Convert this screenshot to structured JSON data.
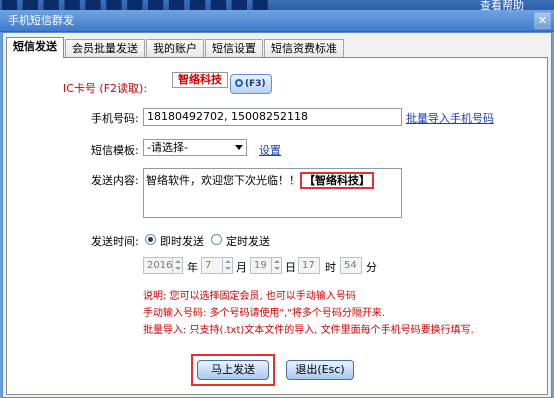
{
  "window": {
    "title": "手机短信群发",
    "close_glyph": "✕",
    "top_link": "查看帮助"
  },
  "tabs": [
    "短信发送",
    "会员批量发送",
    "我的账户",
    "短信设置",
    "短信资费标准"
  ],
  "card": {
    "label": "IC卡号 (F2读取):",
    "value": "智络科技",
    "button": "(F3)"
  },
  "phone": {
    "label": "手机号码:",
    "value": "18180492702, 15008252118",
    "import_link": "批量导入手机号码"
  },
  "template": {
    "label": "短信模板:",
    "selected": "-请选择-",
    "settings_link": "设置"
  },
  "content": {
    "label": "发送内容:",
    "text": "智络软件，欢迎您下次光临！！",
    "signature": "【智络科技】"
  },
  "send_time": {
    "label": "发送时间:",
    "options": [
      "即时发送",
      "定时发送"
    ],
    "selected": "即时发送",
    "year": "2016",
    "year_unit": "年",
    "month": "7",
    "month_unit": "月",
    "day": "19",
    "day_unit": "日",
    "hour": "17",
    "hour_unit": "时",
    "minute": "54",
    "minute_unit": "分"
  },
  "notes": [
    "说明: 您可以选择固定会员, 也可以手动输入号码",
    "手动输入号码: 多个号码请使用\",\"将多个号码分隔开来.",
    "批量导入: 只支持(.txt)文本文件的导入, 文件里面每个手机号码要换行填写."
  ],
  "buttons": {
    "send": "马上发送",
    "exit": "退出(Esc)"
  },
  "colors": {
    "accent_red": "#e53030",
    "link_blue": "#1a3fb8",
    "title_blue": "#3f7ccd"
  }
}
